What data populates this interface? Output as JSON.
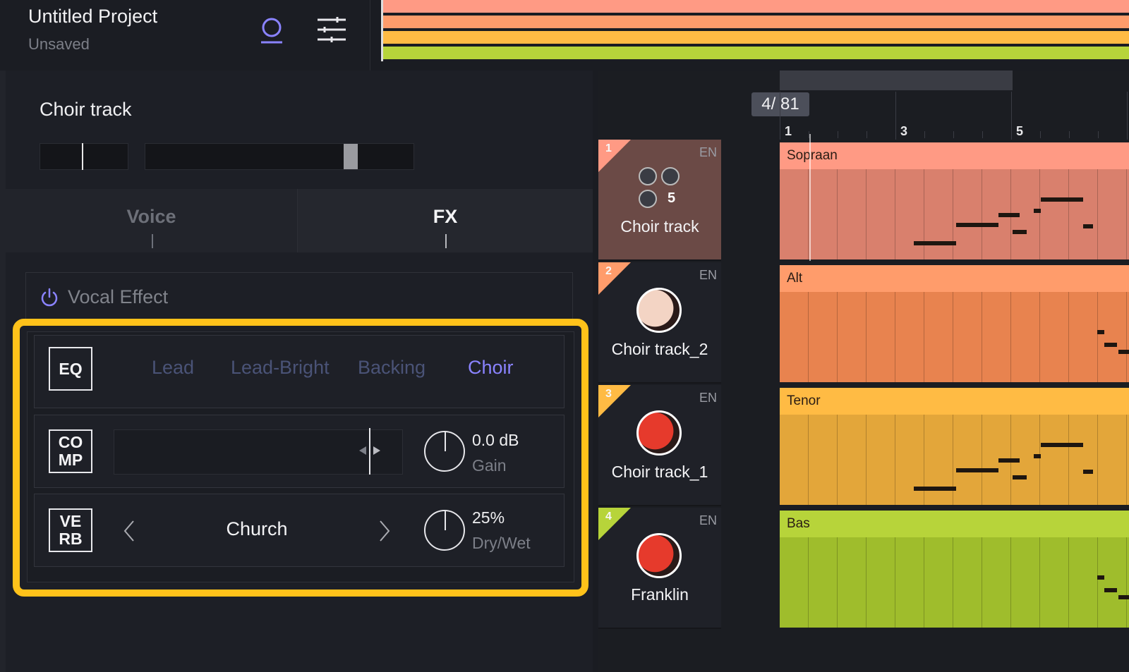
{
  "header": {
    "project_title": "Untitled Project",
    "project_status": "Unsaved",
    "user_icon": "user-icon",
    "settings_icon": "sliders-icon"
  },
  "overview_colors": [
    "#ff9a84",
    "#ff9c6b",
    "#ffbb44",
    "#b7d43a"
  ],
  "track_panel": {
    "track_name": "Choir track",
    "pan_level": 0.48,
    "volume_level": 0.78
  },
  "tabs": [
    {
      "label": "Voice",
      "active": false
    },
    {
      "label": "FX",
      "active": true
    }
  ],
  "vocal_effect": {
    "label": "Vocal Effect",
    "power_icon": "power-icon"
  },
  "eq": {
    "badge": "EQ",
    "presets": [
      "Lead",
      "Lead-Bright",
      "Backing",
      "Choir"
    ],
    "active_preset": "Choir"
  },
  "comp": {
    "badge_line1": "CO",
    "badge_line2": "MP",
    "gain_value": "0.0 dB",
    "gain_label": "Gain"
  },
  "reverb": {
    "badge_line1": "VE",
    "badge_line2": "RB",
    "preset": "Church",
    "prev_icon": "chevron-left-icon",
    "next_icon": "chevron-right-icon",
    "mix_value": "25%",
    "mix_label": "Dry/Wet"
  },
  "timeline": {
    "position": "4/  81",
    "ruler_marks": [
      "1",
      "3",
      "5"
    ]
  },
  "tracks": [
    {
      "num": "1",
      "language": "EN",
      "name": "Choir track",
      "lane": "Sopraan",
      "color": "#ff9a84",
      "lane_body": "#d9806d",
      "group_count": "5"
    },
    {
      "num": "2",
      "language": "EN",
      "name": "Choir track_2",
      "lane": "Alt",
      "color": "#ff9c6b",
      "lane_body": "#e8834f"
    },
    {
      "num": "3",
      "language": "EN",
      "name": "Choir track_1",
      "lane": "Tenor",
      "color": "#ffbb44",
      "lane_body": "#e3a63a"
    },
    {
      "num": "4",
      "language": "EN",
      "name": "Franklin",
      "lane": "Bas",
      "color": "#b7d43a",
      "lane_body": "#9fbd2c"
    }
  ]
}
